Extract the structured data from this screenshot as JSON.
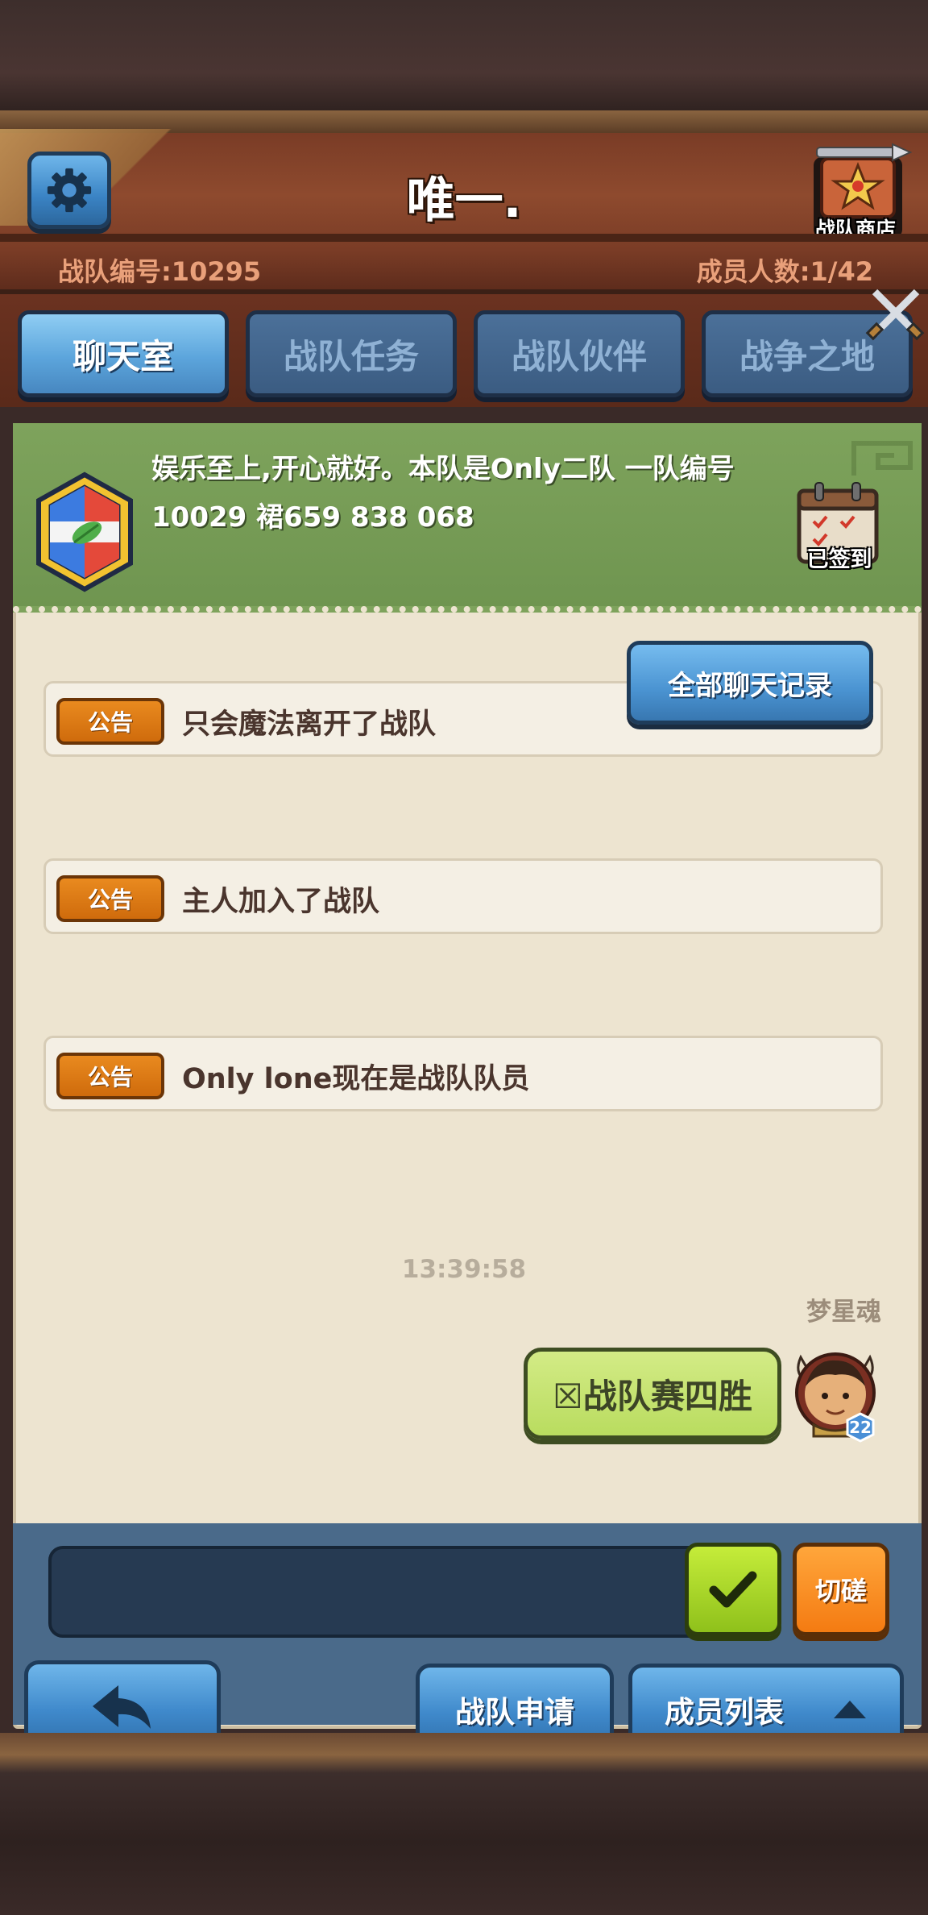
{
  "header": {
    "team_name": "唯一.",
    "team_id_text": "战队编号:10295",
    "member_count_text": "成员人数:1/42",
    "shop_label": "战队商店",
    "settings_icon": "gear-icon"
  },
  "tabs": [
    {
      "label": "聊天室",
      "active": true
    },
    {
      "label": "战队任务",
      "active": false
    },
    {
      "label": "战队伙伴",
      "active": false
    },
    {
      "label": "战争之地",
      "active": false
    }
  ],
  "notice": {
    "line1": "娱乐至上,开心就好。本队是Only二队 一队编号",
    "line2": "10029   裙659 838 068",
    "signin_label": "已签到"
  },
  "history_button": "全部聊天记录",
  "announcements": [
    {
      "badge": "公告",
      "text": "只会魔法离开了战队"
    },
    {
      "badge": "公告",
      "text": "主人加入了战队"
    },
    {
      "badge": "公告",
      "text": "Only lone现在是战队队员"
    }
  ],
  "chat": {
    "timestamp": "13:39:58",
    "sender": "梦星魂",
    "message": "☒战队赛四胜",
    "avatar_level": "22"
  },
  "input": {
    "value": "",
    "placeholder": ""
  },
  "buttons": {
    "spar": "切磋",
    "apply": "战队申请",
    "members": "成员列表"
  },
  "colors": {
    "tab_active": "#5ca5dc",
    "tab_inactive": "#3b5c82",
    "notice_band": "#7ea35c",
    "announce_badge": "#e07b16",
    "send_button": "#a6d62a",
    "spar_button": "#f78c22"
  }
}
